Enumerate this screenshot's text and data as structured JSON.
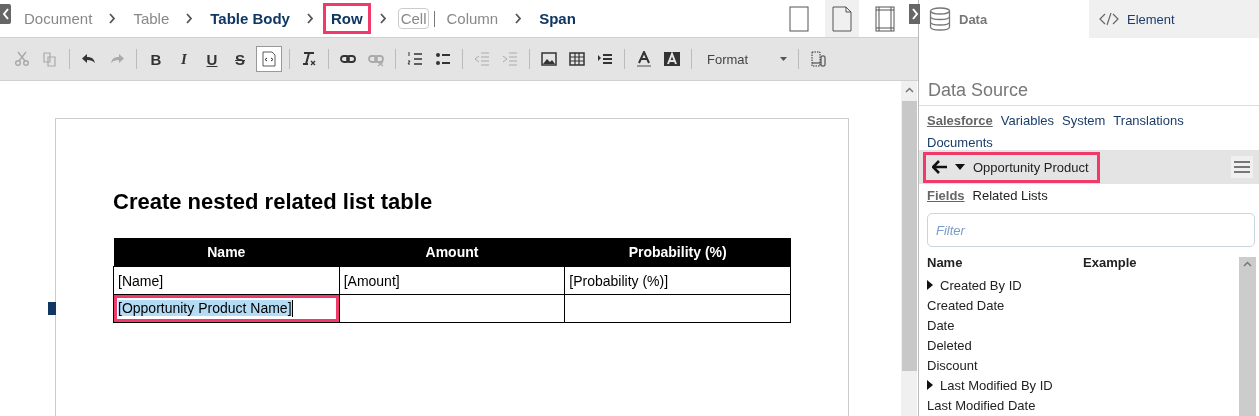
{
  "breadcrumb": [
    {
      "label": "Document",
      "kind": "link",
      "highlighted": false
    },
    {
      "kind": "chevron"
    },
    {
      "label": "Table",
      "kind": "link",
      "highlighted": false
    },
    {
      "kind": "chevron"
    },
    {
      "label": "Table Body",
      "kind": "current",
      "highlighted": false
    },
    {
      "kind": "chevron"
    },
    {
      "label": "Row",
      "kind": "current",
      "highlighted": true
    },
    {
      "kind": "chevron"
    },
    {
      "label": "Cell",
      "kind": "boxed",
      "highlighted": false
    },
    {
      "kind": "bar"
    },
    {
      "label": "Column",
      "kind": "link",
      "highlighted": false
    },
    {
      "kind": "chevron"
    },
    {
      "label": "Span",
      "kind": "current",
      "highlighted": false
    }
  ],
  "page_views": [
    {
      "kind": "plain",
      "selected": false
    },
    {
      "kind": "fold",
      "selected": true
    },
    {
      "kind": "margins",
      "selected": false
    }
  ],
  "toolbar": [
    {
      "kind": "cut",
      "disabled": true
    },
    {
      "kind": "copy",
      "disabled": true
    },
    {
      "kind": "divider"
    },
    {
      "kind": "undo",
      "disabled": false
    },
    {
      "kind": "redo",
      "disabled": true
    },
    {
      "kind": "divider"
    },
    {
      "kind": "bold",
      "glyph": "B"
    },
    {
      "kind": "italic",
      "glyph": "I"
    },
    {
      "kind": "underline",
      "glyph": "U"
    },
    {
      "kind": "strike",
      "glyph": "S"
    },
    {
      "kind": "source",
      "disabled": false
    },
    {
      "kind": "divider"
    },
    {
      "kind": "clear",
      "disabled": false
    },
    {
      "kind": "divider"
    },
    {
      "kind": "link",
      "disabled": false
    },
    {
      "kind": "unlink",
      "disabled": true
    },
    {
      "kind": "divider"
    },
    {
      "kind": "numbered",
      "disabled": false
    },
    {
      "kind": "bulleted",
      "disabled": false
    },
    {
      "kind": "divider"
    },
    {
      "kind": "outdent",
      "disabled": true
    },
    {
      "kind": "indent",
      "disabled": true
    },
    {
      "kind": "divider"
    },
    {
      "kind": "image",
      "disabled": false
    },
    {
      "kind": "table",
      "disabled": false
    },
    {
      "kind": "pagebreak",
      "disabled": false
    },
    {
      "kind": "divider"
    },
    {
      "kind": "textcolor",
      "disabled": false
    },
    {
      "kind": "bgcolor",
      "disabled": false
    },
    {
      "kind": "divider"
    },
    {
      "kind": "dropdown",
      "label": "Format"
    },
    {
      "kind": "divider"
    },
    {
      "kind": "device",
      "disabled": false
    }
  ],
  "document": {
    "heading": "Create nested related list table",
    "table": {
      "columns": [
        "Name",
        "Amount",
        "Probability (%)"
      ],
      "rows": [
        {
          "current": false,
          "cells": [
            {
              "text": "[Name]",
              "selected": false,
              "highlighted": false
            },
            {
              "text": "[Amount]",
              "selected": false,
              "highlighted": false
            },
            {
              "text": "[Probability (%)]",
              "selected": false,
              "highlighted": false
            }
          ]
        },
        {
          "current": true,
          "cells": [
            {
              "text": "[Opportunity Product Name]",
              "selected": true,
              "highlighted": true
            },
            {
              "selected": false,
              "highlighted": false
            },
            {
              "selected": false,
              "highlighted": false
            }
          ]
        }
      ]
    }
  },
  "panel": {
    "tabs": [
      {
        "label": "Data",
        "selected": true
      },
      {
        "label": "Element",
        "selected": false
      }
    ],
    "heading": "Data Source",
    "sources": [
      {
        "label": "Salesforce",
        "selected": true
      },
      {
        "label": "Variables",
        "selected": false
      },
      {
        "label": "System",
        "selected": false
      },
      {
        "label": "Translations",
        "selected": false
      },
      {
        "label": "Documents",
        "selected": false
      }
    ],
    "object": {
      "label": "Opportunity Product",
      "highlighted": true
    },
    "subtabs": [
      {
        "label": "Fields",
        "selected": true
      },
      {
        "label": "Related Lists",
        "selected": false
      }
    ],
    "filter": {
      "placeholder": "Filter"
    },
    "columns": [
      "Name",
      "Example"
    ],
    "fields": [
      {
        "name": "Created By ID",
        "expandable": true
      },
      {
        "name": "Created Date",
        "expandable": false
      },
      {
        "name": "Date",
        "expandable": false
      },
      {
        "name": "Deleted",
        "expandable": false
      },
      {
        "name": "Discount",
        "expandable": false
      },
      {
        "name": "Last Modified By ID",
        "expandable": true
      },
      {
        "name": "Last Modified Date",
        "expandable": false
      }
    ]
  }
}
